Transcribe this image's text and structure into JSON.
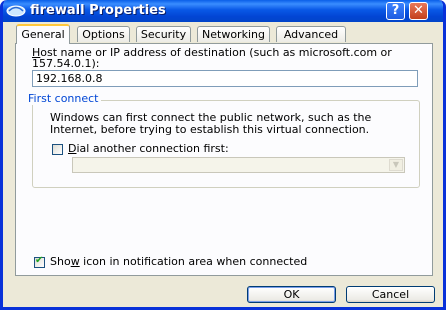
{
  "window": {
    "title": "firewall Properties",
    "help_label": "?",
    "close_label": "✕"
  },
  "tabs": [
    {
      "label": "General",
      "active": true
    },
    {
      "label": "Options",
      "active": false
    },
    {
      "label": "Security",
      "active": false
    },
    {
      "label": "Networking",
      "active": false
    },
    {
      "label": "Advanced",
      "active": false
    }
  ],
  "general": {
    "host_label_line1_u": "H",
    "host_label_line1_rest": "ost name or IP address of destination (such as microsoft.com or",
    "host_label_line2": "157.54.0.1):",
    "host_value": "192.168.0.8",
    "first_connect": {
      "legend": "First connect",
      "description_line1": "Windows can first connect the public network, such as the",
      "description_line2": "Internet, before trying to establish this virtual connection.",
      "dial_checkbox_u": "D",
      "dial_checkbox_rest": "ial another connection first:",
      "dial_checked": false,
      "connection_select_value": ""
    },
    "show_icon_pre": "Sho",
    "show_icon_u": "w",
    "show_icon_rest": " icon in notification area when connected",
    "show_icon_checked": true
  },
  "buttons": {
    "ok_label": "OK",
    "cancel_label": "Cancel"
  },
  "colors": {
    "titlebar": "#0245d4",
    "face": "#ece9d8",
    "tab_highlight": "#ffc83c",
    "group_label": "#0046d5"
  }
}
